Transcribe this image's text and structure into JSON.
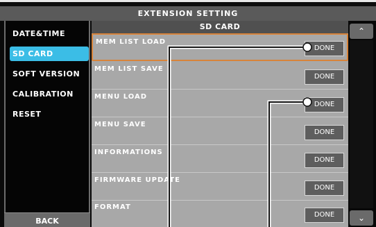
{
  "window": {
    "title": "EXTENSION SETTING"
  },
  "sidebar": {
    "items": [
      {
        "label": "DATE&TIME"
      },
      {
        "label": "SD CARD"
      },
      {
        "label": "SOFT VERSION"
      },
      {
        "label": "CALIBRATION"
      },
      {
        "label": "RESET"
      }
    ],
    "back_label": "BACK"
  },
  "main": {
    "header": "SD CARD",
    "rows": [
      {
        "label": "MEM LIST LOAD",
        "button": "DONE"
      },
      {
        "label": "MEM LIST SAVE",
        "button": "DONE"
      },
      {
        "label": "MENU LOAD",
        "button": "DONE"
      },
      {
        "label": "MENU SAVE",
        "button": "DONE"
      },
      {
        "label": "INFORMATIONS",
        "button": "DONE"
      },
      {
        "label": "FIRMWARE UPDATE",
        "button": "DONE"
      },
      {
        "label": "FORMAT",
        "button": "DONE"
      }
    ]
  },
  "scroll": {
    "up_glyph": "⌃",
    "down_glyph": "⌄"
  },
  "colors": {
    "accent": "#3bbde6",
    "selection_border": "#d8843a",
    "panel": "#a8a8a8"
  }
}
